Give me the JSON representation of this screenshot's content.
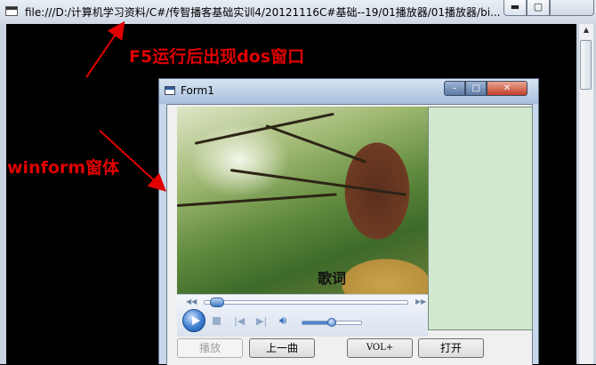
{
  "console": {
    "title": "file:///D:/计算机学习资料/C#/传智播客基础实训4/20121116C#基础--19/01播放器/01播放器/bi...",
    "controls": {
      "min": "▬",
      "max": "▢",
      "close": ""
    }
  },
  "annotations": {
    "dos_label": "F5运行后出现dos窗口",
    "winform_label": "winform窗体",
    "color": "#e00000"
  },
  "form": {
    "title": "Form1",
    "controls": {
      "min": "–",
      "max": "□",
      "close": "✕"
    }
  },
  "player": {
    "lyrics_label": "歌词",
    "seek_progress": 0.03,
    "volume_level": 0.5,
    "icons": [
      "play-icon",
      "stop-icon",
      "previous-icon",
      "next-icon",
      "volume-icon"
    ]
  },
  "buttons": {
    "play": "播放",
    "previous": "上一曲",
    "volume": "VOL+",
    "open": "打开"
  },
  "colors": {
    "side_panel": "#cfe8cf",
    "form_frame": "#c8d7ec"
  }
}
